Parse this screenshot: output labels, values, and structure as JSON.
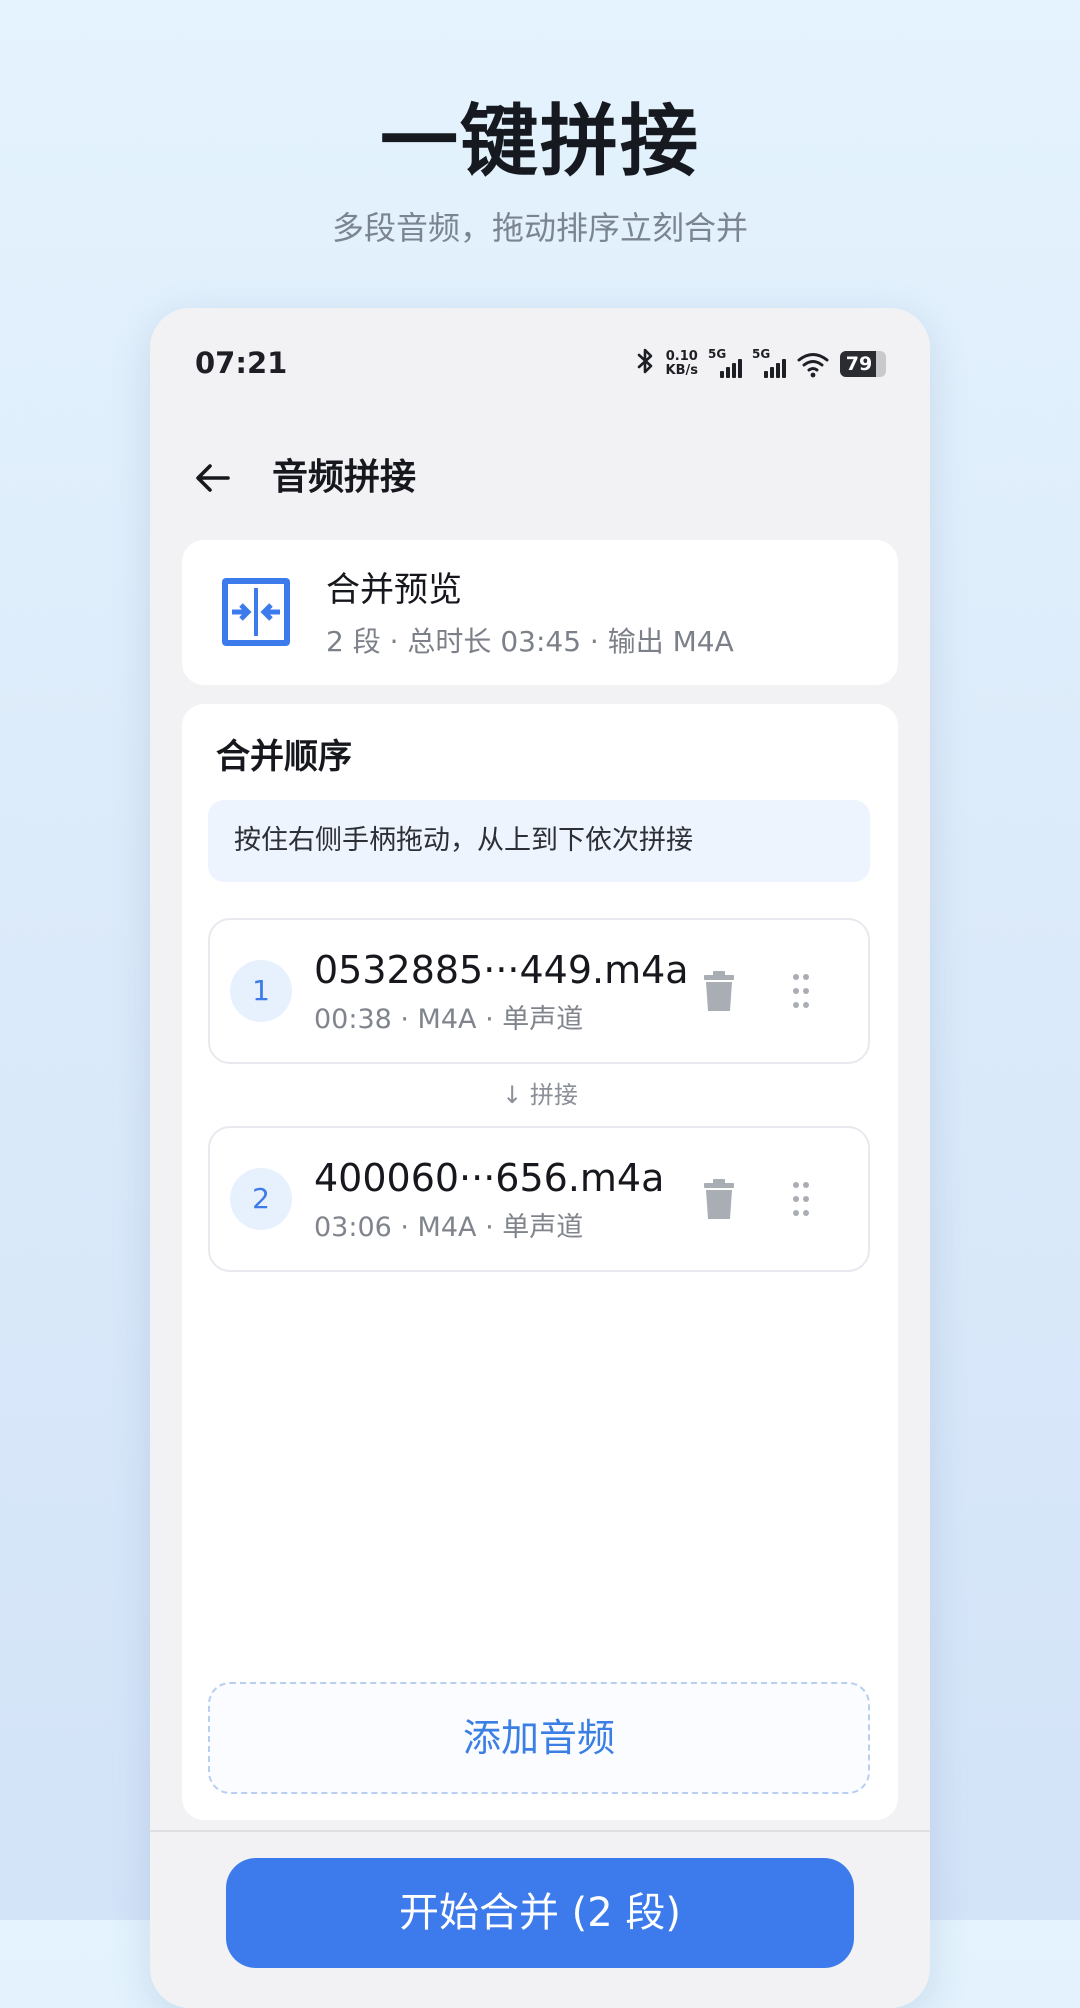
{
  "hero": {
    "title": "一键拼接",
    "subtitle": "多段音频，拖动排序立刻合并"
  },
  "status_bar": {
    "time": "07:21",
    "net_speed_value": "0.10",
    "net_speed_unit": "KB/s",
    "signal_1_label": "5G",
    "signal_2_label": "5G",
    "battery_level": 79,
    "battery_text": "79"
  },
  "header": {
    "title": "音频拼接"
  },
  "preview": {
    "title": "合并预览",
    "meta": "2 段 · 总时长 03:45 · 输出 M4A"
  },
  "order": {
    "title": "合并顺序",
    "hint": "按住右侧手柄拖动，从上到下依次拼接",
    "join_label": "↓ 拼接",
    "clips": [
      {
        "index": "1",
        "name": "0532885···449.m4a",
        "meta": "00:38 · M4A · 单声道"
      },
      {
        "index": "2",
        "name": "400060···656.m4a",
        "meta": "03:06 · M4A · 单声道"
      }
    ]
  },
  "actions": {
    "add_audio": "添加音频",
    "start_merge": "开始合并 (2 段)"
  },
  "colors": {
    "accent": "#3d7bed",
    "badge_bg": "#e7f0fd",
    "hint_bg": "#eef4fd",
    "icon_gray": "#a9adb4"
  }
}
